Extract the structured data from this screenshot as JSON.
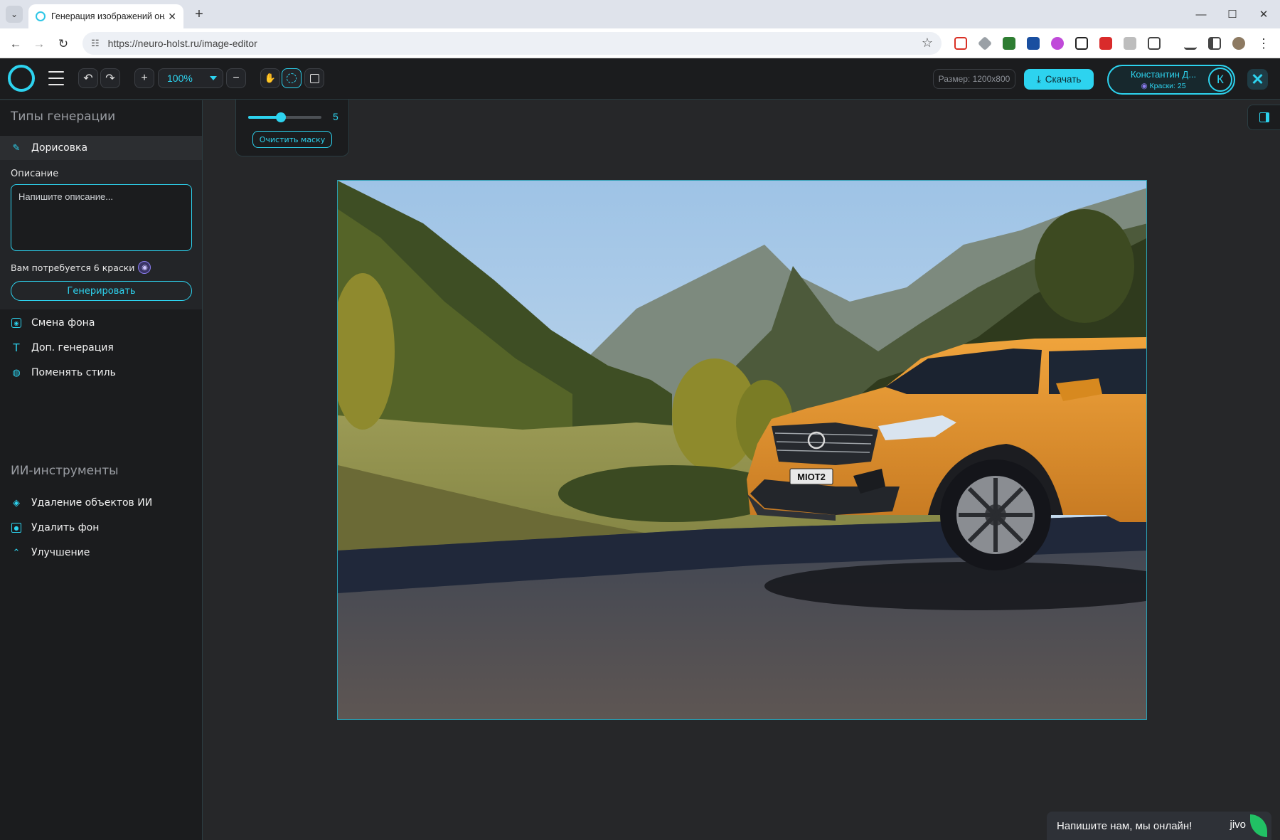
{
  "browser": {
    "tab_title": "Генерация изображений онлайн",
    "url": "https://neuro-holst.ru/image-editor"
  },
  "header": {
    "zoom_value": "100%",
    "size_label": "Размер: 1200x800",
    "download_label": "Скачать",
    "user_name": "Константин Д...",
    "credits_label": "Краски: 25",
    "avatar_letter": "К"
  },
  "brush": {
    "size": "5",
    "level": 0.45,
    "clear_mask_label": "Очистить маску"
  },
  "sidebar": {
    "gen_types_heading": "Типы генерации",
    "ai_tools_heading": "ИИ-инструменты",
    "active_item": "Дорисовка",
    "description_label": "Описание",
    "description_placeholder": "Напишите описание...",
    "cost_text": "Вам потребуется 6 краски",
    "generate_label": "Генерировать",
    "gen_items": [
      {
        "label": "Смена фона",
        "icon": "bg-replace-icon"
      },
      {
        "label": "Доп. генерация",
        "icon": "text-icon"
      },
      {
        "label": "Поменять стиль",
        "icon": "palette-icon"
      }
    ],
    "ai_items": [
      {
        "label": "Удаление объектов ИИ",
        "icon": "eraser-icon"
      },
      {
        "label": "Удалить фон",
        "icon": "remove-bg-icon"
      },
      {
        "label": "Улучшение",
        "icon": "upscale-icon"
      }
    ]
  },
  "image": {
    "plate_text": "MIOT2"
  },
  "chat": {
    "text": "Напишите нам, мы онлайн!",
    "brand": "jivo"
  },
  "colors": {
    "accent": "#2dd3ef",
    "background": "#262729",
    "panel": "#1b1c1e",
    "car": "#e0932e"
  }
}
